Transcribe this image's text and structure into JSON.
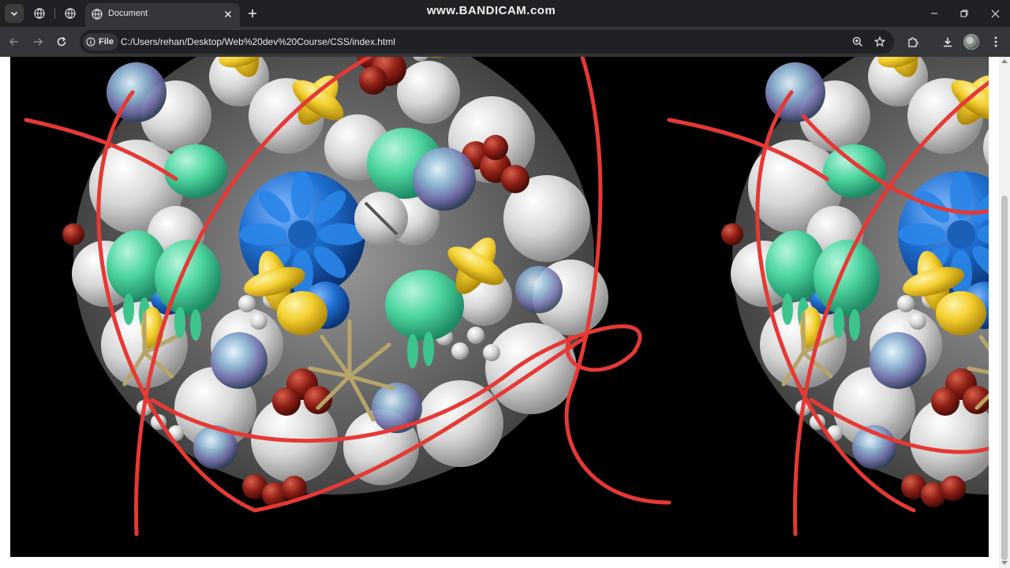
{
  "browser": {
    "tab": {
      "title": "Document"
    },
    "watermark": "www.BANDICAM.com",
    "address_bar": {
      "chip_label": "File",
      "url": "C:/Users/rehan/Desktop/Web%20dev%20Course/CSS/index.html"
    }
  },
  "page": {
    "images": [
      {
        "icon": "sculpture-art-image"
      },
      {
        "icon": "sculpture-art-image"
      }
    ]
  },
  "colors": {
    "chrome_dark": "#202124",
    "toolbar": "#35363a",
    "page_background": "#000000",
    "wire_red": "#e53935",
    "mint": "#4fd6a0",
    "yellow": "#f4cf2f",
    "blue": "#1f6fd1",
    "maroon": "#8e1f16"
  }
}
